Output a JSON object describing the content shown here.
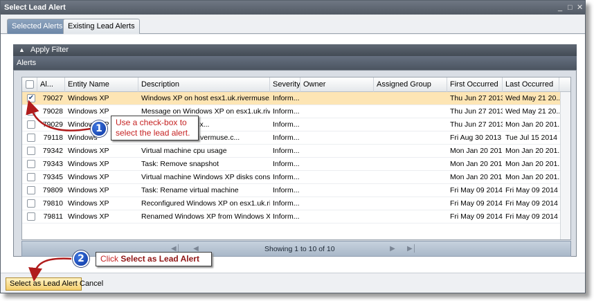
{
  "window": {
    "title": "Select Lead Alert",
    "controls": [
      "_",
      "□",
      "✕"
    ]
  },
  "tabs": [
    {
      "label": "Selected Alerts",
      "active": true
    },
    {
      "label": "Existing Lead Alerts",
      "active": false
    }
  ],
  "filter": {
    "label": "Apply Filter"
  },
  "alerts_title": "Alerts",
  "grid": {
    "columns": [
      "Al...",
      "Entity Name",
      "Description",
      "Severity",
      "Owner",
      "Assigned Group",
      "First Occurred",
      "Last Occurred"
    ],
    "rows": [
      {
        "checked": true,
        "id": "79027",
        "entity": "Windows XP",
        "description": "Windows XP on host esx1.uk.rivermuse.c...",
        "severity": "Inform...",
        "owner": "",
        "group": "",
        "first": "Thu Jun 27 2013...",
        "last": "Wed May 21 20..."
      },
      {
        "checked": false,
        "id": "79028",
        "entity": "Windows XP",
        "description": "Message on Windows XP on esx1.uk.river...",
        "severity": "Inform...",
        "owner": "",
        "group": "",
        "first": "Thu Jun 27 2013...",
        "last": "Wed May 21 20..."
      },
      {
        "checked": false,
        "id": "79029",
        "entity": "Windows XP",
        "description": "...ndows XP on esx...",
        "severity": "Inform...",
        "owner": "",
        "group": "",
        "first": "Thu Jun 27 2013...",
        "last": "Mon Jan 20 201..."
      },
      {
        "checked": false,
        "id": "79118",
        "entity": "Windows",
        "description": "...XP on esx1.uk.rivermuse.c...",
        "severity": "Inform...",
        "owner": "",
        "group": "",
        "first": "Fri Aug 30 2013 ...",
        "last": "Tue Jul 15 2014 ..."
      },
      {
        "checked": false,
        "id": "79342",
        "entity": "Windows XP",
        "description": "Virtual machine cpu usage",
        "severity": "Inform...",
        "owner": "",
        "group": "",
        "first": "Mon Jan 20 201...",
        "last": "Mon Jan 20 201..."
      },
      {
        "checked": false,
        "id": "79343",
        "entity": "Windows XP",
        "description": "Task: Remove snapshot",
        "severity": "Inform...",
        "owner": "",
        "group": "",
        "first": "Mon Jan 20 201...",
        "last": "Mon Jan 20 201..."
      },
      {
        "checked": false,
        "id": "79345",
        "entity": "Windows XP",
        "description": "Virtual machine Windows XP disks consoli...",
        "severity": "Inform...",
        "owner": "",
        "group": "",
        "first": "Mon Jan 20 201...",
        "last": "Mon Jan 20 201..."
      },
      {
        "checked": false,
        "id": "79809",
        "entity": "Windows XP",
        "description": "Task: Rename virtual machine",
        "severity": "Inform...",
        "owner": "",
        "group": "",
        "first": "Fri May 09 2014 ...",
        "last": "Fri May 09 2014 ..."
      },
      {
        "checked": false,
        "id": "79810",
        "entity": "Windows XP",
        "description": "Reconfigured Windows XP on esx1.uk.rive...",
        "severity": "Inform...",
        "owner": "",
        "group": "",
        "first": "Fri May 09 2014 ...",
        "last": "Fri May 09 2014 ..."
      },
      {
        "checked": false,
        "id": "79811",
        "entity": "Windows XP",
        "description": "Renamed Windows XP from Windows XP ...",
        "severity": "Inform...",
        "owner": "",
        "group": "",
        "first": "Fri May 09 2014 ...",
        "last": "Fri May 09 2014 ..."
      }
    ]
  },
  "pager": {
    "status": "Showing 1 to 10 of 10"
  },
  "footer": {
    "select_label": "Select as Lead Alert",
    "cancel_label": "Cancel"
  },
  "callouts": {
    "one": {
      "number": "1",
      "text": "Use a check-box to select the lead alert."
    },
    "two": {
      "number": "2",
      "prefix": "Click ",
      "bold": "Select as Lead Alert"
    }
  },
  "colors": {
    "accent": "#6d87a8",
    "selected_row": "#fde5b4",
    "callout_text": "#c52222",
    "badge": "#0b34a0"
  }
}
